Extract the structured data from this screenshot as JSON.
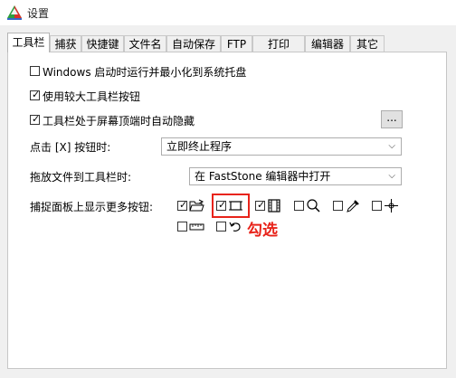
{
  "window": {
    "title": "设置"
  },
  "tabs": [
    "工具栏",
    "捕获",
    "快捷键",
    "文件名",
    "自动保存",
    "FTP",
    "打印",
    "编辑器",
    "其它"
  ],
  "options": {
    "startup_label": "Windows 启动时运行并最小化到系统托盘",
    "large_buttons_label": "使用较大工具栏按钮",
    "autohide_label": "工具栏处于屏幕顶端时自动隐藏",
    "autohide_more_button": "...",
    "click_x_label": "点击 [X] 按钮时:",
    "click_x_value": "立即终止程序",
    "drag_label": "拖放文件到工具栏时:",
    "drag_value": "在 FastStone 编辑器中打开",
    "capture_panel_label": "捕捉面板上显示更多按钮:"
  },
  "checkbox_states": {
    "startup": false,
    "large_buttons": true,
    "autohide": true,
    "open_folder": true,
    "rectangle_capture": true,
    "film": true,
    "magnifier": false,
    "color_picker": false,
    "crosshair": false,
    "ruler": false,
    "undo": false
  },
  "icons": [
    "folder-open-icon",
    "rectangle-capture-icon",
    "film-strip-icon",
    "magnifier-icon",
    "color-picker-icon",
    "crosshair-icon",
    "ruler-icon",
    "undo-arrow-icon"
  ],
  "annotation": {
    "text": "勾选",
    "color": "#e8231a"
  },
  "check_glyph": "✓",
  "dropdown_glyph": "⌵"
}
